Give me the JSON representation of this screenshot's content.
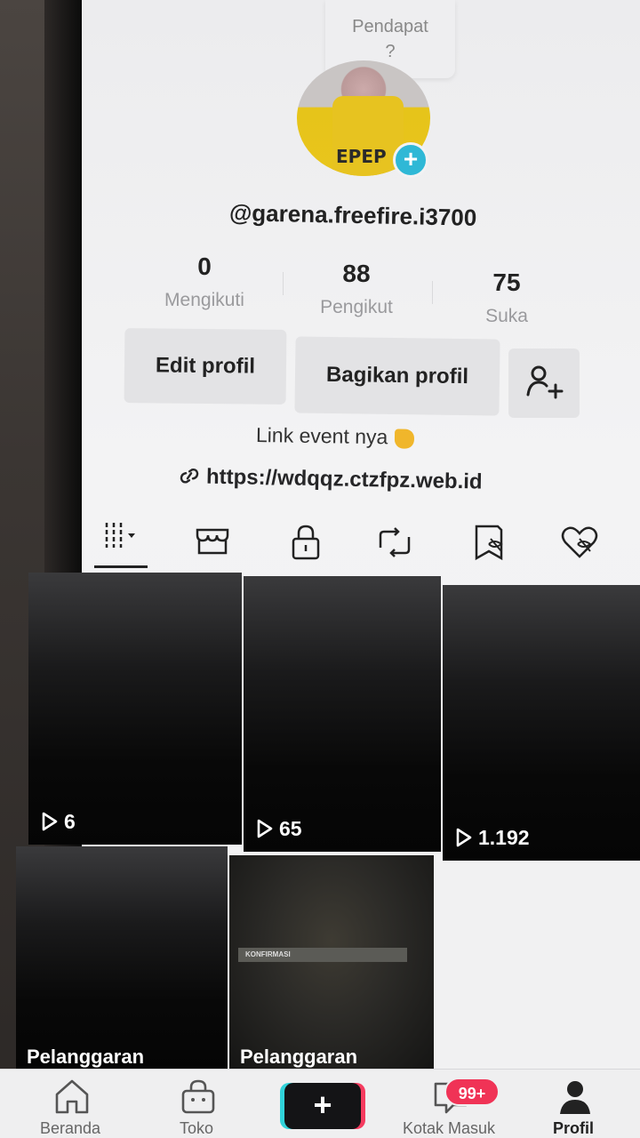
{
  "tooltip": {
    "line1": "Pendapat",
    "line2": "?"
  },
  "profile": {
    "username": "@garena.freefire.i3700",
    "avatar_text": "EPEP",
    "stats": {
      "following": {
        "value": "0",
        "label": "Mengikuti"
      },
      "followers": {
        "value": "88",
        "label": "Pengikut"
      },
      "likes": {
        "value": "75",
        "label": "Suka"
      }
    },
    "buttons": {
      "edit": "Edit profil",
      "share": "Bagikan profil"
    },
    "bio": "Link event nya",
    "link": "https://wdqqz.ctzfpz.web.id"
  },
  "tabs": [
    "videos-grid-icon",
    "shop-icon",
    "lock-icon",
    "repost-icon",
    "saved-icon",
    "liked-icon"
  ],
  "videos": [
    {
      "views": "6"
    },
    {
      "views": "65"
    },
    {
      "views": "1.192"
    },
    {
      "label": "Pelanggaran"
    },
    {
      "label": "Pelanggaran",
      "overlay": "KONFIRMASI"
    },
    {}
  ],
  "bottom_nav": {
    "home": "Beranda",
    "shop": "Toko",
    "inbox": "Kotak Masuk",
    "profile": "Profil",
    "inbox_badge": "99+",
    "create": "+"
  },
  "colors": {
    "accent_cyan": "#2fb8d6",
    "badge_red": "#f03356",
    "tiktok_cyan": "#31d3da",
    "tiktok_pink": "#f53b5f"
  }
}
